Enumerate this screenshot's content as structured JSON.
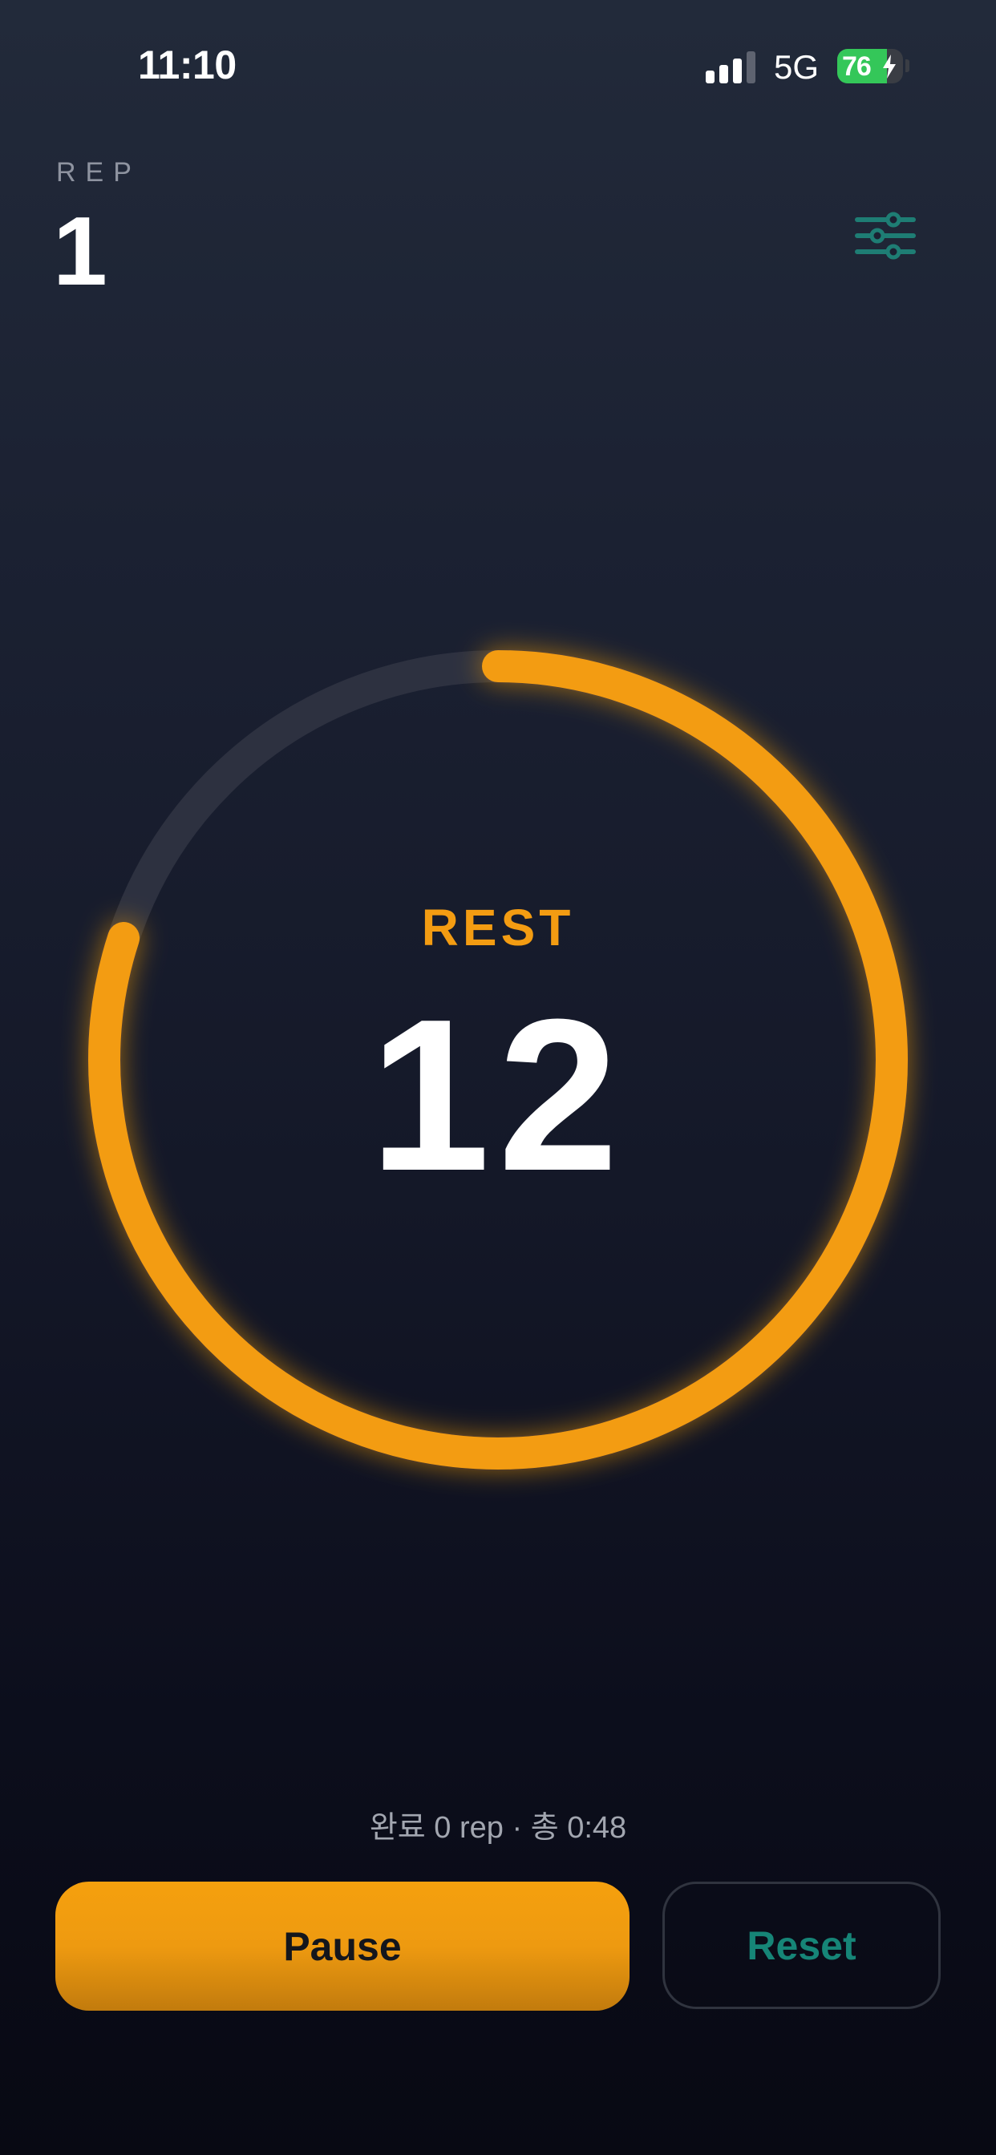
{
  "status_bar": {
    "time": "11:10",
    "network": "5G",
    "battery_percent": "76",
    "battery_level": 0.76,
    "battery_charging": true,
    "signal_bars_active": 3,
    "signal_bars_total": 4
  },
  "header": {
    "rep_label": "REP",
    "rep_value": "1",
    "settings_icon": "sliders-icon"
  },
  "timer": {
    "phase": "REST",
    "countdown": "12",
    "progress_remaining": 0.8
  },
  "summary": {
    "text": "완료 0 rep · 총 0:48"
  },
  "buttons": {
    "pause_label": "Pause",
    "reset_label": "Reset"
  },
  "colors": {
    "accent": "#f39c12",
    "reset_text": "#168577",
    "settings_icon": "#1e7d74",
    "ring_track": "#2d3140",
    "battery_green": "#34c759"
  }
}
